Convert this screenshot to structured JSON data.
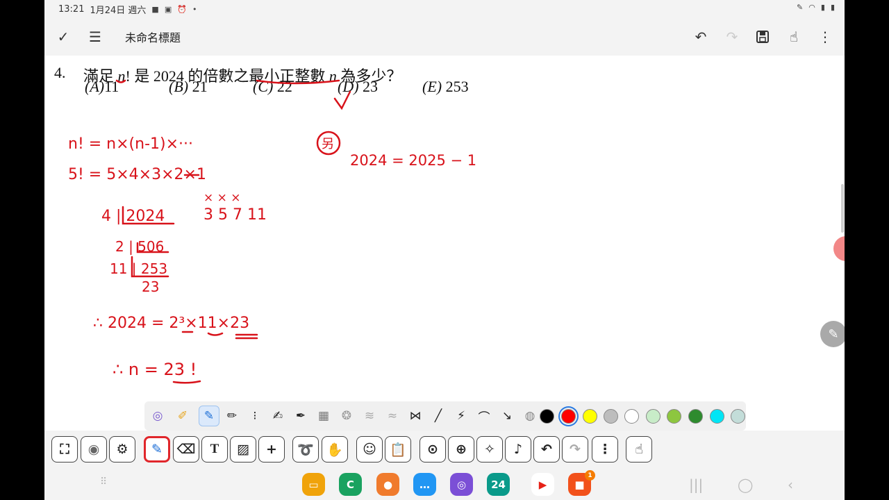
{
  "status": {
    "time": "13:21",
    "date": "1月24日 週六",
    "icons": [
      "video-icon",
      "gallery-icon",
      "alarm-icon",
      "dot-icon"
    ],
    "right_icons": [
      "pen-icon",
      "wifi-icon",
      "signal-icon",
      "battery-icon"
    ]
  },
  "appbar": {
    "title": "未命名標題"
  },
  "problem": {
    "number": "4.",
    "question_parts": [
      "滿足 ",
      "n",
      "! 是 2024 的倍數之最小正整數 ",
      "n",
      " 為多少？"
    ],
    "options": [
      {
        "letter": "(A)",
        "value": "11"
      },
      {
        "letter": "(B)",
        "value": "21"
      },
      {
        "letter": "(C)",
        "value": "22"
      },
      {
        "letter": "(D)",
        "value": "23"
      },
      {
        "letter": "(E)",
        "value": "253"
      }
    ]
  },
  "handwriting": {
    "line1": "n! = n×(n-1)×···",
    "line2": "5! = 5×4×3×2×1",
    "xs": "× × ×",
    "primes": "3 5 7 11",
    "div1": "4 | 2024",
    "div2": "2 | 506",
    "div3": "11 | 253",
    "div4": "23",
    "result1": "∴ 2024 = 2³×11×23",
    "result2": "∴ n = 23 !",
    "side_label": "另",
    "side_eq": "2024 = 2025 − 1"
  },
  "colors": {
    "ink": "#d8121a",
    "accent_active": "#e0262b"
  },
  "palette": {
    "swatches": [
      "#000000",
      "#ff0000",
      "#ffff00",
      "#bdbdbd",
      "#ffffff",
      "#c8ecc8",
      "#8dc63f",
      "#2e8b2e",
      "#00e5f5",
      "#c3ddd9"
    ],
    "selected": "#ff0000"
  },
  "dock": {
    "badge": "1",
    "calendar_day": "24"
  }
}
